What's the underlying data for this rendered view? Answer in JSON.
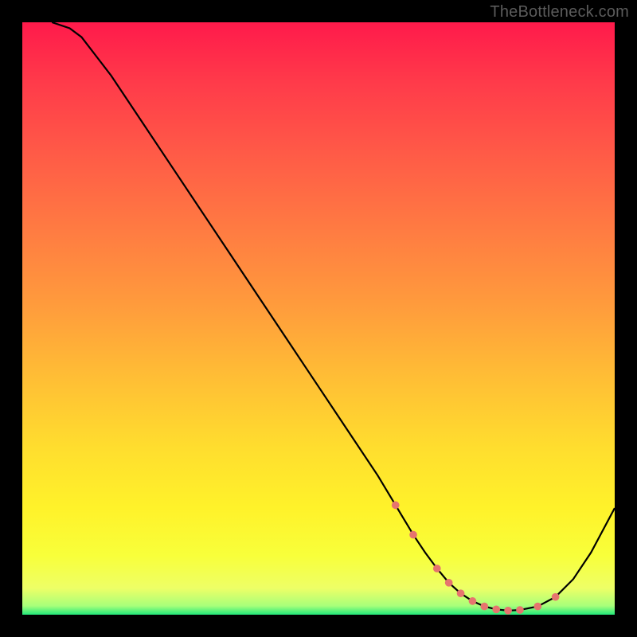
{
  "watermark": "TheBottleneck.com",
  "gradient_stops": [
    {
      "offset": 0.0,
      "color": "#ff1a4b"
    },
    {
      "offset": 0.1,
      "color": "#ff3a4a"
    },
    {
      "offset": 0.22,
      "color": "#ff5a47"
    },
    {
      "offset": 0.35,
      "color": "#ff7b42"
    },
    {
      "offset": 0.48,
      "color": "#ff9c3c"
    },
    {
      "offset": 0.6,
      "color": "#ffbe35"
    },
    {
      "offset": 0.72,
      "color": "#ffde2e"
    },
    {
      "offset": 0.82,
      "color": "#fff22a"
    },
    {
      "offset": 0.9,
      "color": "#f8ff3a"
    },
    {
      "offset": 0.955,
      "color": "#eeff66"
    },
    {
      "offset": 0.985,
      "color": "#a8ff7a"
    },
    {
      "offset": 1.0,
      "color": "#22e87a"
    }
  ],
  "chart_data": {
    "type": "line",
    "title": "",
    "xlabel": "",
    "ylabel": "",
    "xlim": [
      0,
      100
    ],
    "ylim": [
      0,
      100
    ],
    "grid": false,
    "legend": false,
    "x": [
      5,
      8,
      10,
      15,
      20,
      25,
      30,
      35,
      40,
      45,
      50,
      55,
      60,
      63,
      66,
      68,
      70,
      72,
      74,
      76,
      78,
      80,
      82,
      84,
      87,
      90,
      93,
      96,
      100
    ],
    "values": [
      100,
      99,
      97.5,
      91,
      83.5,
      76,
      68.5,
      61,
      53.5,
      46,
      38.5,
      31,
      23.5,
      18.5,
      13.5,
      10.5,
      7.8,
      5.4,
      3.6,
      2.3,
      1.4,
      0.9,
      0.7,
      0.8,
      1.4,
      3.0,
      6.0,
      10.5,
      18.0
    ],
    "markers": {
      "x": [
        63,
        66,
        70,
        72,
        74,
        76,
        78,
        80,
        82,
        84,
        87,
        90
      ],
      "y": [
        18.5,
        13.5,
        7.8,
        5.4,
        3.6,
        2.3,
        1.4,
        0.9,
        0.7,
        0.8,
        1.4,
        3.0
      ]
    }
  }
}
